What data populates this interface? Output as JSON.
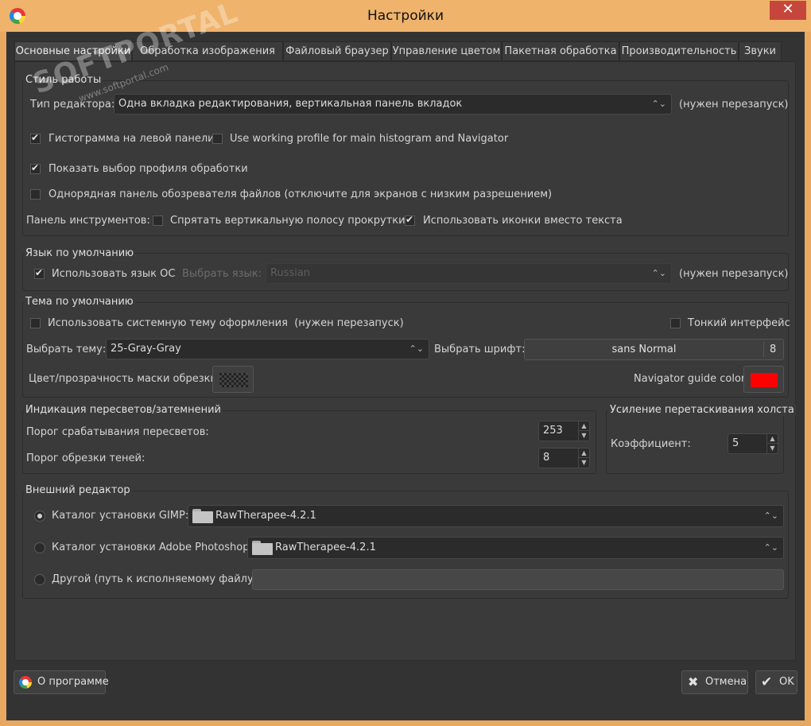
{
  "window": {
    "title": "Настройки",
    "close_glyph": "✕",
    "icon": "rawtherapee-logo-icon"
  },
  "watermark": {
    "brand": "SOFTPORTAL",
    "url": "www.softportal.com"
  },
  "tabs": [
    {
      "label": "Основные настройки"
    },
    {
      "label": "Обработка изображения"
    },
    {
      "label": "Файловый браузер"
    },
    {
      "label": "Управление цветом"
    },
    {
      "label": "Пакетная обработка"
    },
    {
      "label": "Производительность"
    },
    {
      "label": "Звуки"
    }
  ],
  "style_group": {
    "title": "Стиль работы",
    "editor_type_label": "Тип редактора:",
    "editor_type_value": "Одна вкладка редактирования, вертикальная панель вкладок",
    "restart_note": "(нужен перезапуск)",
    "histogram_left": {
      "label": "Гистограмма на левой панели",
      "checked": true
    },
    "working_profile": {
      "label": "Use working profile for main histogram and Navigator",
      "checked": false
    },
    "show_profile": {
      "label": "Показать выбор профиля обработки",
      "checked": true
    },
    "single_row": {
      "label": "Однорядная панель обозревателя файлов (отключите для экранов с низким разрешением)",
      "checked": false
    },
    "toolbar_label": "Панель инструментов:",
    "hide_scrollbar": {
      "label": "Спрятать вертикальную полосу прокрутки",
      "checked": false
    },
    "use_icons": {
      "label": "Использовать иконки вместо текста",
      "checked": true
    }
  },
  "language_group": {
    "title": "Язык по умолчанию",
    "use_os": {
      "label": "Использовать язык ОС",
      "checked": true
    },
    "choose_label": "Выбрать язык:",
    "language_value": "Russian",
    "restart_note": "(нужен перезапуск)"
  },
  "theme_group": {
    "title": "Тема по умолчанию",
    "system_theme": {
      "label": "Использовать системную тему оформления",
      "checked": false
    },
    "system_theme_note": "(нужен перезапуск)",
    "thin_ui": {
      "label": "Тонкий интерфейс",
      "checked": false
    },
    "theme_label": "Выбрать тему:",
    "theme_value": "25-Gray-Gray",
    "font_label": "Выбрать шрифт:",
    "font_name": "sans Normal",
    "font_size": "8",
    "crop_mask_label": "Цвет/прозрачность маски обрезки:",
    "navigator_label": "Navigator guide color:",
    "navigator_color": "#ff0000"
  },
  "clipping_group": {
    "title": "Индикация пересветов/затемнений",
    "highlight_label": "Порог срабатывания пересветов:",
    "highlight_value": "253",
    "shadow_label": "Порог обрезки теней:",
    "shadow_value": "8"
  },
  "pan_group": {
    "title": "Усиление перетаскивания холста",
    "factor_label": "Коэффициент:",
    "factor_value": "5"
  },
  "editor_group": {
    "title": "Внешний редактор",
    "gimp": {
      "label": "Каталог установки GIMP:",
      "value": "RawTherapee-4.2.1",
      "selected": true
    },
    "photoshop": {
      "label": "Каталог установки Adobe Photoshop:",
      "value": "RawTherapee-4.2.1",
      "selected": false
    },
    "other": {
      "label": "Другой (путь к исполняемому файлу):",
      "value": "",
      "selected": false
    }
  },
  "footer": {
    "about_label": "О программе",
    "cancel_label": "Отмена",
    "ok_label": "OK"
  },
  "glyphs": {
    "combo_arrows": "⌃⌄",
    "spin_up": "▲",
    "spin_down": "▼",
    "cancel": "✖",
    "ok": "✔"
  }
}
